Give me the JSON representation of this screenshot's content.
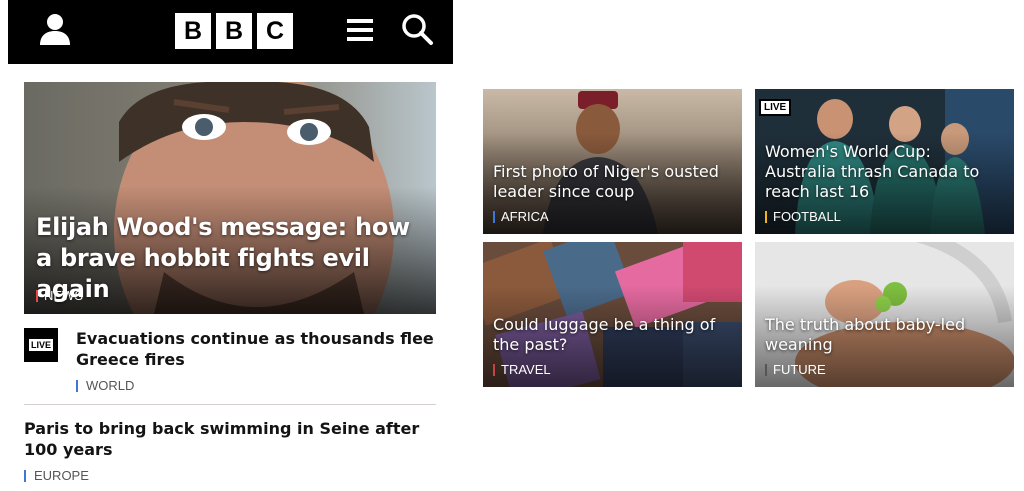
{
  "header": {
    "logo_letters": [
      "B",
      "B",
      "C"
    ],
    "icons": [
      "user-icon",
      "menu-icon",
      "search-icon"
    ]
  },
  "hero": {
    "title": "Elijah Wood's message: how a brave hobbit fights evil again",
    "tag": "NEWS",
    "tag_color": "#e64b4b"
  },
  "stories": [
    {
      "badge": "LIVE",
      "title": "Evacuations continue as thousands flee Greece fires",
      "tag": "WORLD",
      "tag_color": "#3d78d8"
    },
    {
      "title": "Paris to bring back swimming in Seine after 100 years",
      "tag": "EUROPE",
      "tag_color": "#3d78d8"
    }
  ],
  "cards": [
    {
      "title": "First photo of Niger's ousted leader since coup",
      "tag": "AFRICA",
      "tag_color": "#3d78d8"
    },
    {
      "badge": "LIVE",
      "title": "Women's World Cup: Australia thrash Canada to reach last 16",
      "tag": "FOOTBALL",
      "tag_color": "#f2b41c"
    },
    {
      "title": "Could luggage be a thing of the past?",
      "tag": "TRAVEL",
      "tag_color": "#c44343"
    },
    {
      "title": "The truth about baby-led weaning",
      "tag": "FUTURE",
      "tag_color": "#555555"
    }
  ]
}
